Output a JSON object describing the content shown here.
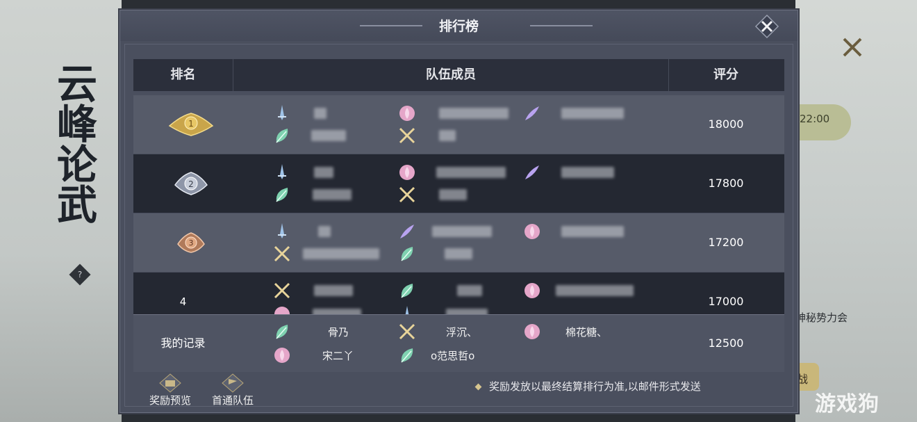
{
  "background": {
    "calligraphy": "云峰论武",
    "help_glyph": "?",
    "time_badge": "22:00",
    "side_text": "神秘势力会",
    "side_button": "战",
    "watermark": "游戏狗"
  },
  "panel": {
    "title": "排行榜",
    "columns": {
      "rank": "排名",
      "members": "队伍成员",
      "score": "评分"
    }
  },
  "rows": [
    {
      "rank": "1",
      "score": "18000",
      "medal": "gold"
    },
    {
      "rank": "2",
      "score": "17800",
      "medal": "silver"
    },
    {
      "rank": "3",
      "score": "17200",
      "medal": "bronze"
    },
    {
      "rank": "4",
      "score": "17000",
      "medal": "none"
    }
  ],
  "my_record": {
    "label": "我的记录",
    "score": "12500",
    "members": [
      "骨乃",
      "宋二丫",
      "浮沉、",
      "o范思哲o",
      "棉花糖、"
    ]
  },
  "footer": {
    "reward_preview": "奖励预览",
    "first_clear_team": "首通队伍",
    "notice": "奖励发放以最终结算排行为准,以邮件形式发送"
  },
  "colors": {
    "panel": "#4a4f5e",
    "header": "#2b2f3b",
    "row_light": "#565b69",
    "row_dark": "#242832",
    "accent": "#d6c58f"
  }
}
